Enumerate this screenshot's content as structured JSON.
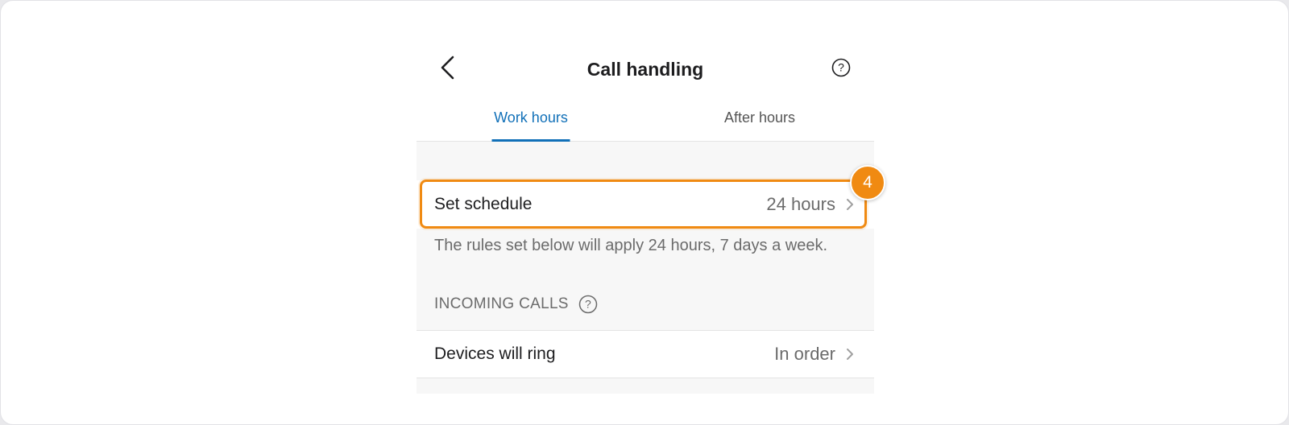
{
  "header": {
    "title": "Call handling"
  },
  "tabs": [
    {
      "label": "Work hours",
      "active": true
    },
    {
      "label": "After hours",
      "active": false
    }
  ],
  "schedule_row": {
    "label": "Set schedule",
    "value": "24 hours"
  },
  "schedule_note": "The rules set below will apply 24 hours, 7 days a week.",
  "incoming": {
    "section_label": "INCOMING CALLS",
    "row_label": "Devices will ring",
    "row_value": "In order"
  },
  "step_badge": "4",
  "colors": {
    "accent_blue": "#1170b8",
    "highlight_orange": "#f08a12"
  },
  "icons": [
    "back-icon",
    "help-icon",
    "chevron-right-icon"
  ]
}
